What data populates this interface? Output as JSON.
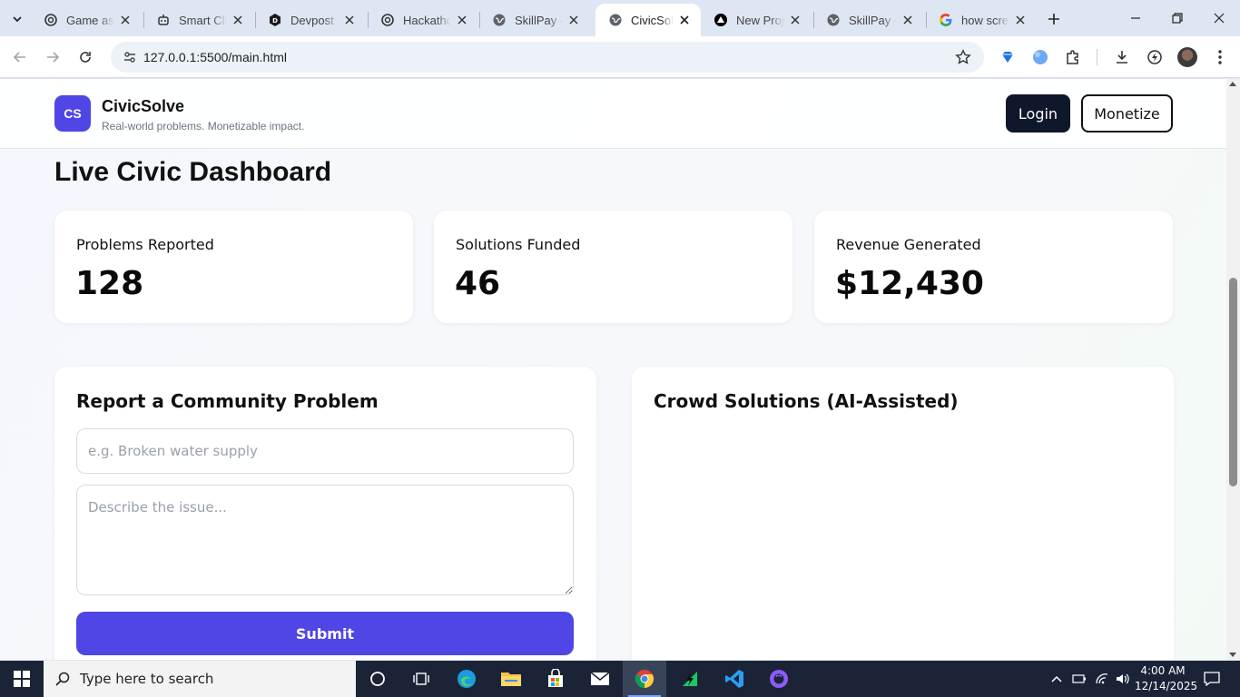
{
  "browser": {
    "tabs": [
      {
        "label": "Game ass",
        "icon": "chatgpt-icon"
      },
      {
        "label": "Smart Cli",
        "icon": "bot-icon"
      },
      {
        "label": "Devpost",
        "icon": "devpost-icon"
      },
      {
        "label": "Hackatho",
        "icon": "chatgpt-icon"
      },
      {
        "label": "SkillPay –",
        "icon": "globe-icon"
      },
      {
        "label": "CivicSolve",
        "icon": "globe-icon",
        "active": true
      },
      {
        "label": "New Proje",
        "icon": "vercel-icon"
      },
      {
        "label": "SkillPay –",
        "icon": "globe-icon"
      },
      {
        "label": "how scree",
        "icon": "google-icon"
      }
    ],
    "url": "127.0.0.1:5500/main.html"
  },
  "site": {
    "logo_text": "CS",
    "brand": "CivicSolve",
    "tagline": "Real-world problems. Monetizable impact.",
    "login_label": "Login",
    "monetize_label": "Monetize"
  },
  "dashboard": {
    "title": "Live Civic Dashboard",
    "stats": [
      {
        "label": "Problems Reported",
        "value": "128"
      },
      {
        "label": "Solutions Funded",
        "value": "46"
      },
      {
        "label": "Revenue Generated",
        "value": "$12,430"
      }
    ]
  },
  "report": {
    "title": "Report a Community Problem",
    "title_placeholder": "e.g. Broken water supply",
    "desc_placeholder": "Describe the issue...",
    "submit_label": "Submit"
  },
  "solutions": {
    "title": "Crowd Solutions (AI-Assisted)"
  },
  "taskbar": {
    "search_placeholder": "Type here to search",
    "time": "4:00 AM",
    "date": "12/14/2025"
  },
  "colors": {
    "accent": "#4f46e5",
    "dark_button": "#0f172a",
    "taskbar": "#1b2437"
  }
}
